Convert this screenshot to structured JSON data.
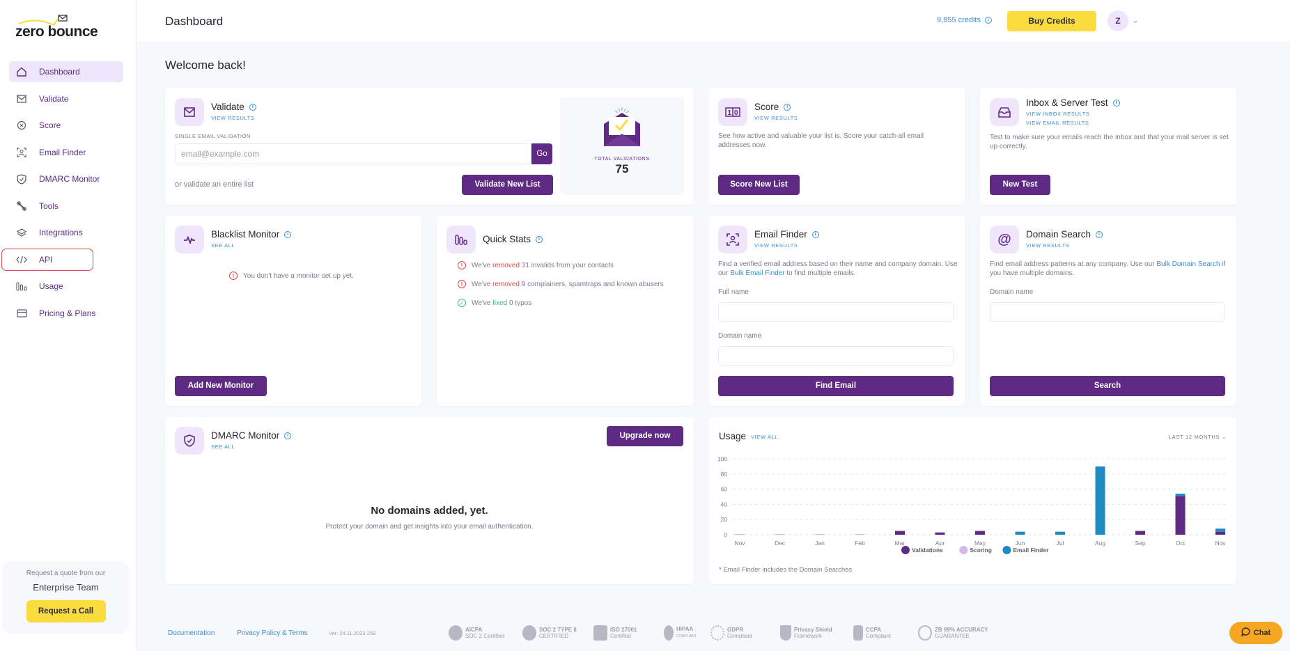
{
  "brand": {
    "name": "zero bounce"
  },
  "sidebar": {
    "items": [
      {
        "label": "Dashboard",
        "icon": "home-icon",
        "active": true
      },
      {
        "label": "Validate",
        "icon": "envelope-icon"
      },
      {
        "label": "Score",
        "icon": "score-icon"
      },
      {
        "label": "Email Finder",
        "icon": "user-scan-icon"
      },
      {
        "label": "DMARC Monitor",
        "icon": "shield-check-icon"
      },
      {
        "label": "Tools",
        "icon": "wrench-icon"
      },
      {
        "label": "Integrations",
        "icon": "layers-icon"
      },
      {
        "label": "API",
        "icon": "code-icon",
        "highlighted": true
      },
      {
        "label": "Usage",
        "icon": "bar-chart-icon"
      },
      {
        "label": "Pricing & Plans",
        "icon": "credit-card-icon"
      }
    ],
    "enterprise": {
      "line1": "Request a quote from our",
      "line2": "Enterprise Team",
      "button": "Request a Call"
    }
  },
  "header": {
    "title": "Dashboard",
    "credits": "9,855 credits",
    "buy_button": "Buy Credits",
    "avatar_initial": "Z"
  },
  "welcome": "Welcome back!",
  "validate": {
    "title": "Validate",
    "link": "VIEW RESULTS",
    "single_label": "SINGLE EMAIL VALIDATION",
    "placeholder": "email@example.com",
    "go": "Go",
    "list_text": "or validate an entire list",
    "list_button": "Validate New List",
    "total_label": "TOTAL VALIDATIONS",
    "total_value": "75"
  },
  "score": {
    "title": "Score",
    "link": "VIEW RESULTS",
    "desc": "See how active and valuable your list is. Score your catch-all email addresses now.",
    "button": "Score New List"
  },
  "inbox": {
    "title": "Inbox & Server Test",
    "link1": "VIEW INBOX RESULTS",
    "link2": "VIEW EMAIL RESULTS",
    "desc": "Test to make sure your emails reach the inbox and that your mail server is set up correctly.",
    "button": "New Test"
  },
  "blacklist": {
    "title": "Blacklist Monitor",
    "link": "SEE ALL",
    "empty": "You don't have a monitor set up yet.",
    "button": "Add New Monitor"
  },
  "quick_stats": {
    "title": "Quick Stats",
    "items": [
      {
        "prefix": "We've",
        "verb": "removed",
        "rest": "31 invalids from your contacts",
        "status": "warning"
      },
      {
        "prefix": "We've",
        "verb": "removed",
        "rest": "9 complainers, spamtraps and known abusers",
        "status": "warning"
      },
      {
        "prefix": "We've",
        "verb": "fixed",
        "rest": "0 typos",
        "status": "ok"
      }
    ]
  },
  "email_finder": {
    "title": "Email Finder",
    "link": "VIEW RESULTS",
    "desc_pre": "Find a verified email address based on their name and company domain. Use our",
    "desc_link": "Bulk Email Finder",
    "desc_post": "to find multiple emails.",
    "full_name_label": "Full name",
    "domain_label": "Domain name",
    "button": "Find Email"
  },
  "domain_search": {
    "title": "Domain Search",
    "link": "VIEW RESULTS",
    "desc_pre": "Find email address patterns at any company. Use our",
    "desc_link": "Bulk Domain Search",
    "desc_post": "if you have multiple domains.",
    "domain_label": "Domain name",
    "button": "Search"
  },
  "dmarc": {
    "title": "DMARC Monitor",
    "link": "SEE ALL",
    "button": "Upgrade now",
    "empty_title": "No domains added, yet.",
    "empty_desc": "Protect your domain and get insights into your email authentication."
  },
  "usage": {
    "title": "Usage",
    "link": "VIEW ALL",
    "range": "LAST 12 MONTHS",
    "note": "* Email Finder includes the Domain Searches"
  },
  "chart_data": {
    "type": "bar",
    "stacked": true,
    "categories": [
      "Nov",
      "Dec",
      "Jan",
      "Feb",
      "Mar",
      "Apr",
      "May",
      "Jun",
      "Jul",
      "Aug",
      "Sep",
      "Oct",
      "Nov"
    ],
    "series": [
      {
        "name": "Validations",
        "color": "#5e2a84",
        "values": [
          0,
          0,
          0,
          0,
          5,
          3,
          5,
          0,
          0,
          0,
          5,
          51,
          4
        ]
      },
      {
        "name": "Scoring",
        "color": "#d4b8e8",
        "values": [
          0,
          0,
          0,
          0,
          0,
          0,
          0,
          0,
          0,
          0,
          0,
          0,
          0
        ]
      },
      {
        "name": "Email Finder",
        "color": "#1e8bc3",
        "values": [
          0,
          0,
          0,
          0,
          0,
          0,
          0,
          4,
          4,
          90,
          0,
          3,
          4
        ]
      }
    ],
    "yticks": [
      0,
      20,
      40,
      60,
      80,
      100
    ],
    "ylim": [
      0,
      100
    ],
    "grid": true,
    "legend": "bottom"
  },
  "footer": {
    "links": [
      "Documentation",
      "Privacy Policy & Terms"
    ],
    "version": "Ver: 24.11.2023-259",
    "badges": [
      {
        "l1": "AICPA",
        "l2": "SOC 2 Certified"
      },
      {
        "l1": "SOC 2 TYPE II",
        "l2": "CERTIFIED"
      },
      {
        "l1": "ISO 27001",
        "l2": "Certified"
      },
      {
        "l1": "HIPAA",
        "l2": "COMPLIANT"
      },
      {
        "l1": "GDPR",
        "l2": "Compliant"
      },
      {
        "l1": "Privacy Shield",
        "l2": "Framework"
      },
      {
        "l1": "CCPA",
        "l2": "Compliant"
      },
      {
        "l1": "ZB 99% ACCURACY",
        "l2": "GUARANTEE"
      }
    ],
    "chat": "Chat"
  }
}
